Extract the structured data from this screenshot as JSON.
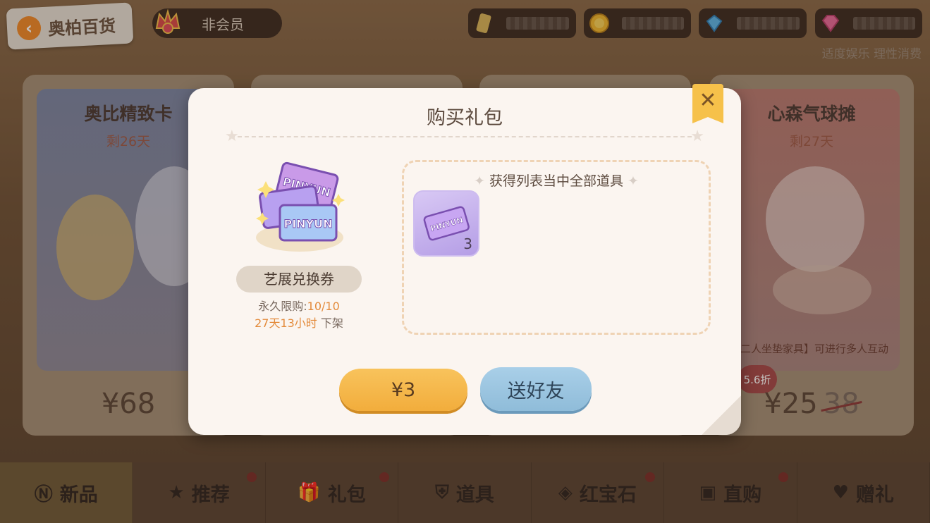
{
  "header": {
    "back_label": "奥柏百货",
    "member_status": "非会员",
    "notice": "适度娱乐 理性消费"
  },
  "cards": [
    {
      "title": "奥比精致卡",
      "days": "剩26天",
      "price": "¥68"
    },
    {
      "title": "心森气球摊",
      "days": "剩27天",
      "desc": "二人坐垫家具】可进行多人互动",
      "price": "¥25",
      "old_price": "38",
      "discount": "5.6折"
    }
  ],
  "modal": {
    "title": "购买礼包",
    "close_label": "✕",
    "item_name": "艺展兑换券",
    "limit_label": "永久限购:",
    "limit_value": "10/10",
    "offline_time": "27天13小时",
    "offline_label": "下架",
    "reward_title": "获得列表当中全部道具",
    "reward_qty": "3",
    "ticket_text": "PINYUN",
    "price_button": "¥3",
    "gift_button": "送好友"
  },
  "nav": [
    {
      "label": "新品",
      "icon": "new-icon",
      "glyph": "Ⓝ"
    },
    {
      "label": "推荐",
      "icon": "star-icon",
      "glyph": "★"
    },
    {
      "label": "礼包",
      "icon": "gift-icon",
      "glyph": "🎁"
    },
    {
      "label": "道具",
      "icon": "tool-icon",
      "glyph": "⛨"
    },
    {
      "label": "红宝石",
      "icon": "ruby-icon",
      "glyph": "◈"
    },
    {
      "label": "直购",
      "icon": "bag-icon",
      "glyph": "▣"
    },
    {
      "label": "赠礼",
      "icon": "heart-icon",
      "glyph": "♥"
    }
  ],
  "colors": {
    "accent_orange": "#f2ad3c",
    "accent_blue": "#8fbcd9",
    "highlight": "#e38a3a"
  }
}
